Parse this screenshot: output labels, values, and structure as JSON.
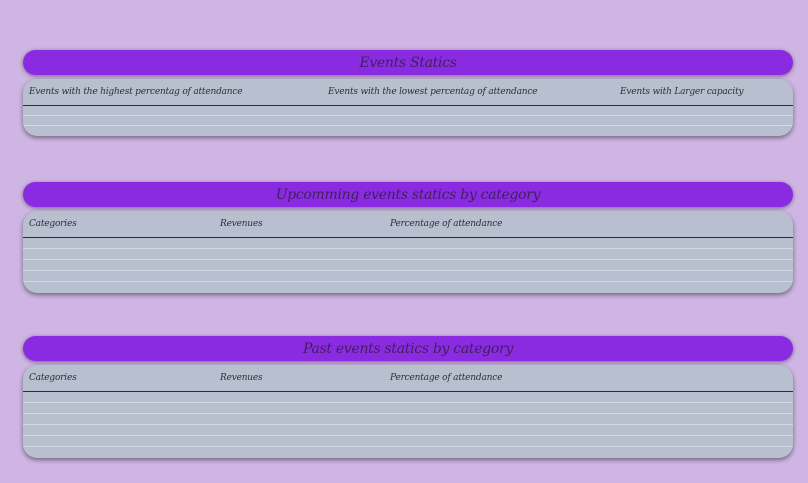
{
  "sections": [
    {
      "title": "Events Statics",
      "columns": [
        "Events with the highest percentag of attendance",
        "Events with the lowest percentag of attendance",
        "Events with Larger capacity"
      ],
      "rows": 3
    },
    {
      "title": "Upcomming events statics by category",
      "columns": [
        "Categories",
        "Revenues",
        "Percentage of attendance"
      ],
      "rows": 5
    },
    {
      "title": "Past events statics by category",
      "columns": [
        "Categories",
        "Revenues",
        "Percentage of attendance"
      ],
      "rows": 6
    }
  ]
}
